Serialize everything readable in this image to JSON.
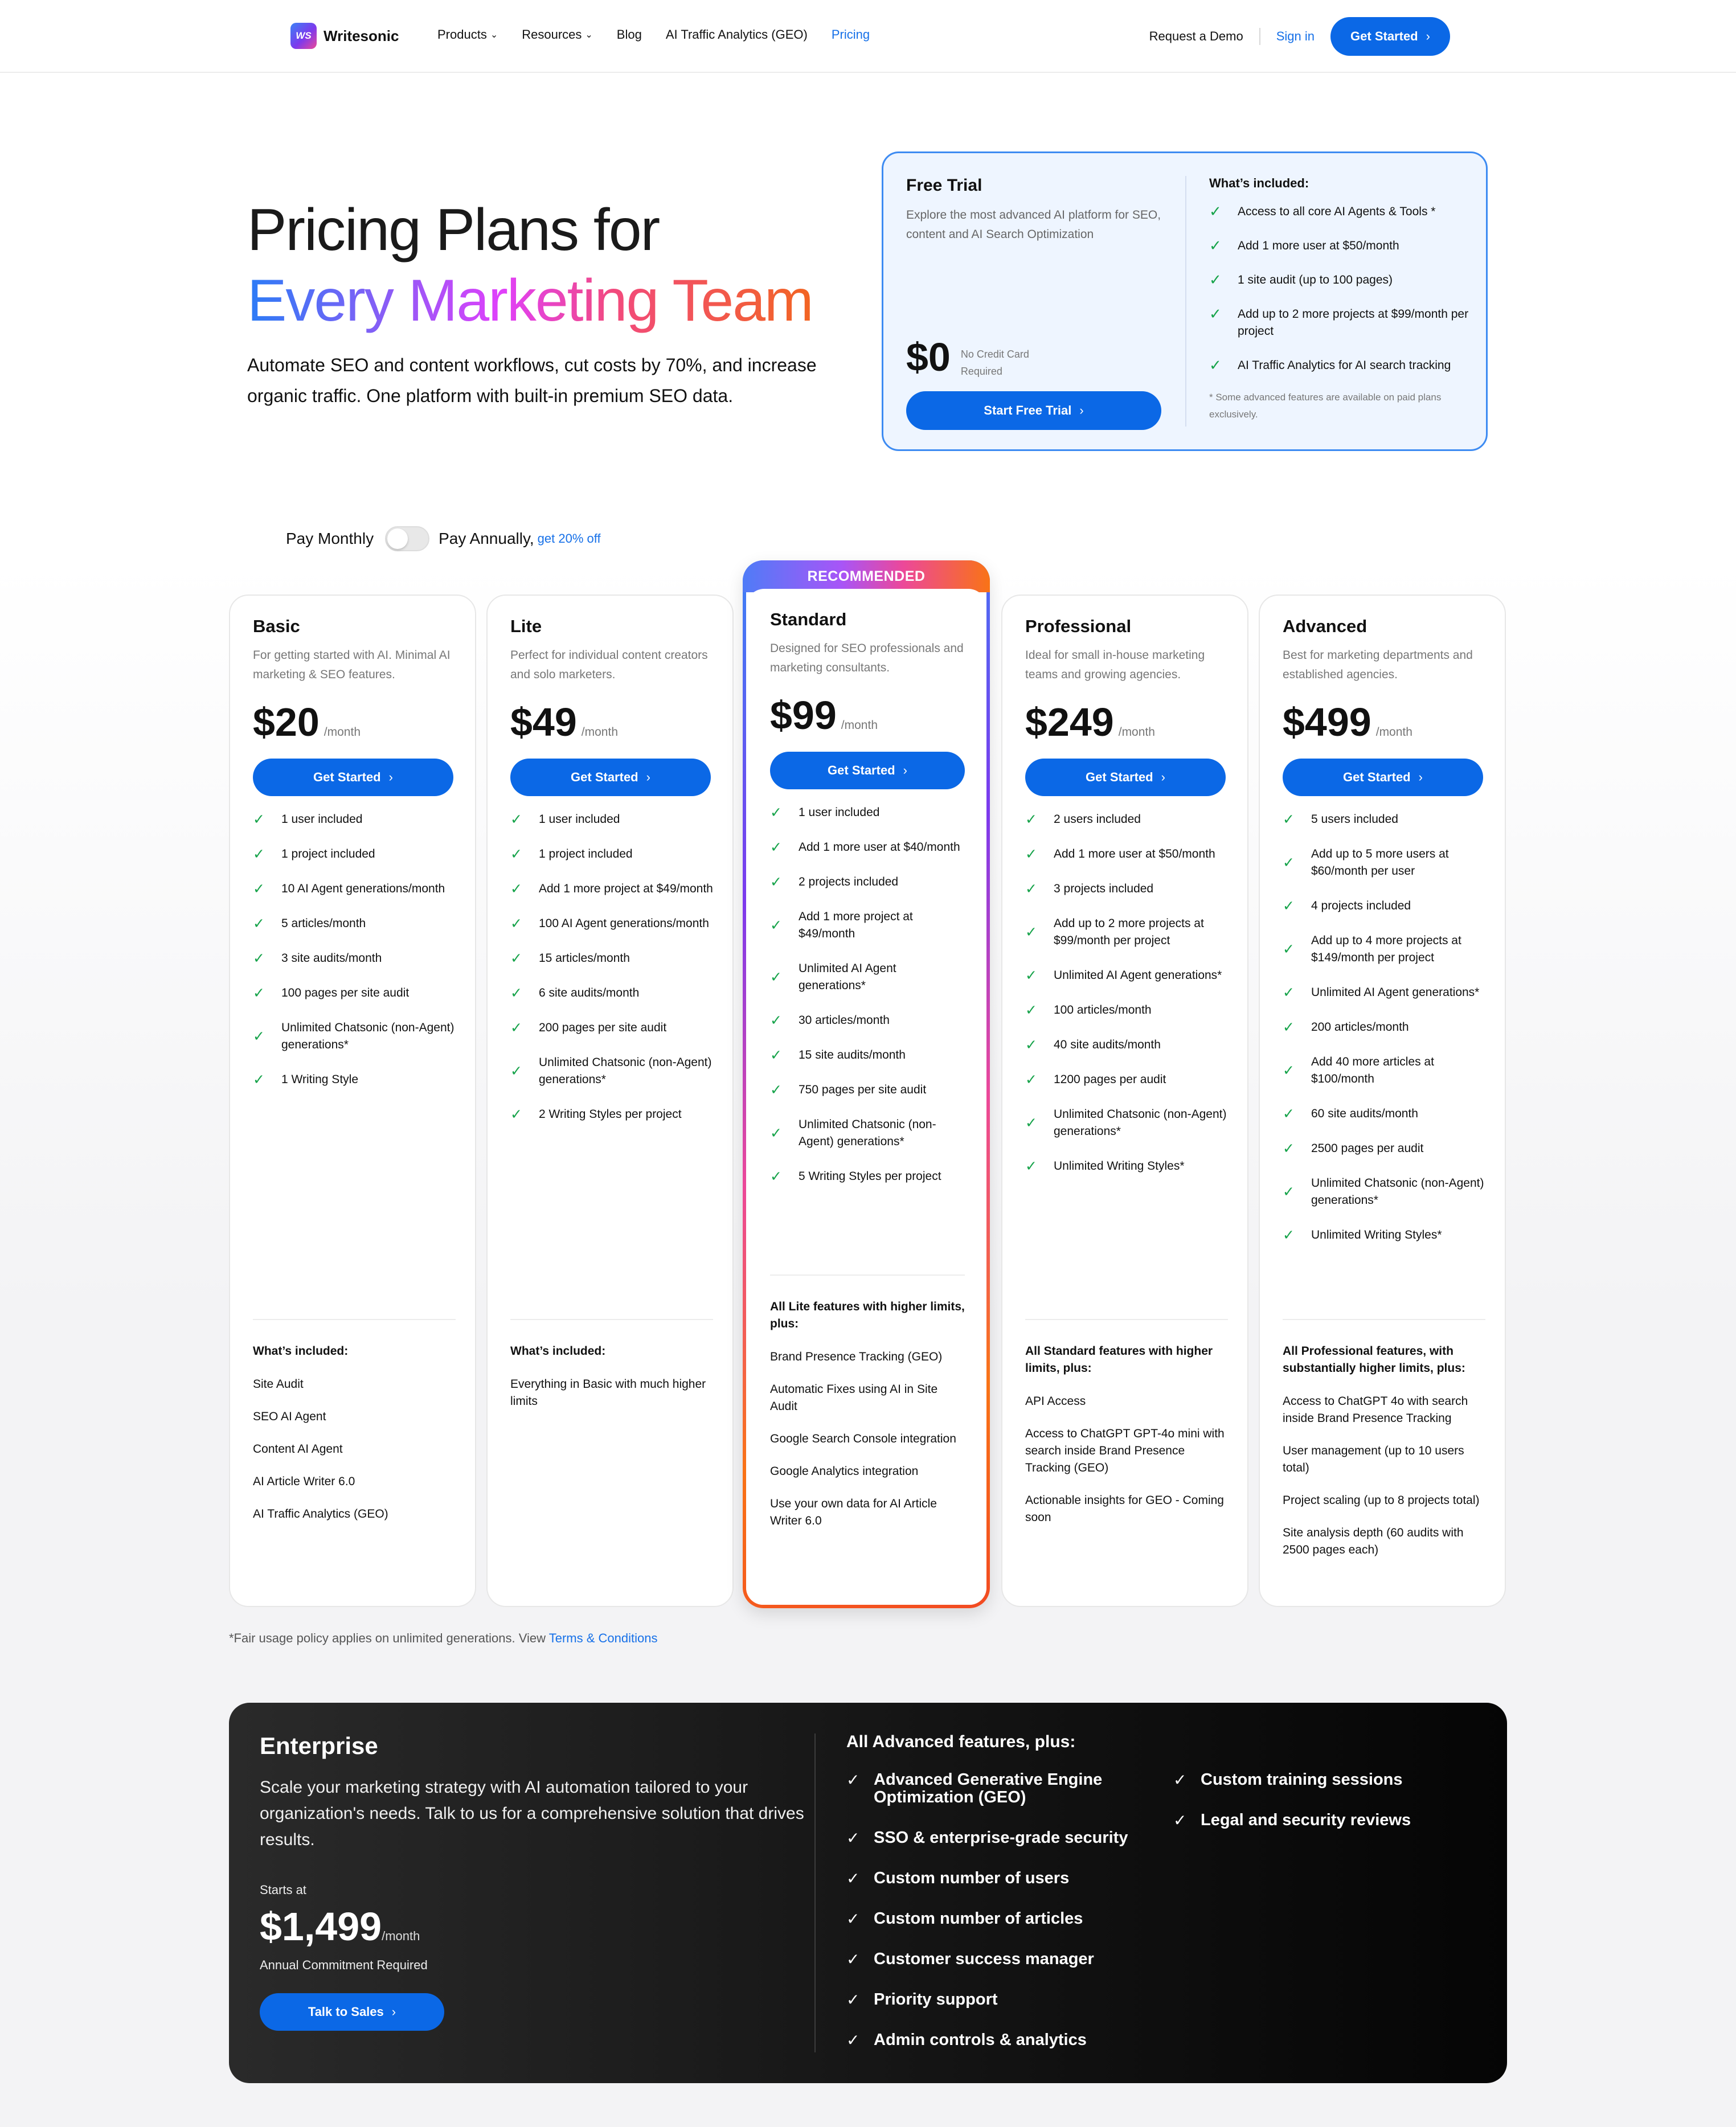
{
  "nav": {
    "logo_mark": "WS",
    "logo_text": "Writesonic",
    "links": [
      {
        "label": "Products",
        "dropdown": true
      },
      {
        "label": "Resources",
        "dropdown": true
      },
      {
        "label": "Blog",
        "dropdown": false
      },
      {
        "label": "AI Traffic Analytics (GEO)",
        "dropdown": false
      },
      {
        "label": "Pricing",
        "dropdown": false,
        "active": true
      }
    ],
    "demo": "Request a Demo",
    "signin": "Sign in",
    "cta": "Get Started"
  },
  "hero": {
    "title_line1": "Pricing Plans for",
    "title_line2": "Every Marketing Team",
    "subtitle": "Automate SEO and content workflows, cut costs by 70%, and increase organic traffic. One platform with built-in premium SEO data."
  },
  "trial": {
    "title": "Free Trial",
    "description": "Explore the most advanced AI platform for SEO, content and AI Search Optimization",
    "price": "$0",
    "price_note": "No Credit Card Required",
    "cta": "Start Free Trial",
    "included_heading": "What’s included:",
    "included": [
      "Access to all core AI Agents & Tools *",
      "Add 1 more user at $50/month",
      "1 site audit (up to 100 pages)",
      "Add up to 2 more projects at $99/month per project",
      "AI Traffic Analytics for AI search tracking"
    ],
    "footnote": "* Some advanced features are available on paid plans exclusively."
  },
  "billing": {
    "monthly_label": "Pay Monthly",
    "annual_label": "Pay Annually,",
    "discount": "get 20% off",
    "annual_selected": false
  },
  "plans": [
    {
      "name": "Basic",
      "description": "For getting started with AI. Minimal AI marketing & SEO features.",
      "price": "$20",
      "period": "/month",
      "cta": "Get Started",
      "features": [
        "1 user included",
        "1 project included",
        "10 AI Agent generations/month",
        "5 articles/month",
        "3 site audits/month",
        "100 pages per site audit",
        "Unlimited Chatsonic (non-Agent) generations*",
        "1 Writing Style"
      ],
      "included_heading": "What’s included:",
      "included": [
        "Site Audit",
        "SEO AI Agent",
        "Content AI Agent",
        "AI Article Writer 6.0",
        "AI Traffic Analytics (GEO)"
      ]
    },
    {
      "name": "Lite",
      "description": "Perfect for individual content creators and solo marketers.",
      "price": "$49",
      "period": "/month",
      "cta": "Get Started",
      "features": [
        "1 user included",
        "1 project included",
        "Add 1 more project at $49/month",
        "100 AI Agent generations/month",
        "15 articles/month",
        "6 site audits/month",
        "200 pages per site audit",
        "Unlimited Chatsonic (non-Agent) generations*",
        "2 Writing Styles per project"
      ],
      "included_heading": "What’s included:",
      "included": [
        "Everything in Basic with much higher limits"
      ]
    },
    {
      "name": "Standard",
      "badge": "RECOMMENDED",
      "description": "Designed for SEO professionals and marketing consultants.",
      "price": "$99",
      "period": "/month",
      "cta": "Get Started",
      "features": [
        "1 user included",
        "Add 1 more user at $40/month",
        "2 projects included",
        "Add 1 more project at $49/month",
        "Unlimited AI Agent generations*",
        "30 articles/month",
        "15 site audits/month",
        "750 pages per site audit",
        "Unlimited Chatsonic (non-Agent) generations*",
        "5 Writing Styles per project"
      ],
      "included_heading": "All Lite features with higher limits, plus:",
      "included": [
        "Brand Presence Tracking (GEO)",
        "Automatic Fixes using AI in Site Audit",
        "Google Search Console integration",
        "Google Analytics integration",
        "Use your own data for AI Article Writer 6.0"
      ]
    },
    {
      "name": "Professional",
      "description": "Ideal for small in-house marketing teams and growing agencies.",
      "price": "$249",
      "period": "/month",
      "cta": "Get Started",
      "features": [
        "2 users included",
        "Add 1 more user at $50/month",
        "3 projects included",
        "Add up to 2 more projects at $99/month per project",
        "Unlimited AI Agent generations*",
        "100 articles/month",
        "40 site audits/month",
        "1200 pages per audit",
        "Unlimited Chatsonic (non-Agent) generations*",
        "Unlimited Writing Styles*"
      ],
      "included_heading": "All Standard features with higher limits, plus:",
      "included": [
        "API Access",
        "Access to ChatGPT GPT-4o mini with search inside Brand Presence Tracking (GEO)",
        "Actionable insights for GEO - Coming soon"
      ]
    },
    {
      "name": "Advanced",
      "description": "Best for marketing departments and established agencies.",
      "price": "$499",
      "period": "/month",
      "cta": "Get Started",
      "features": [
        "5 users included",
        "Add up to 5 more users at $60/month per user",
        "4 projects included",
        "Add up to 4 more projects at $149/month per project",
        "Unlimited AI Agent generations*",
        "200 articles/month",
        "Add 40 more articles at $100/month",
        "60 site audits/month",
        "2500 pages per audit",
        "Unlimited Chatsonic (non-Agent) generations*",
        "Unlimited Writing Styles*"
      ],
      "included_heading": "All Professional features, with substantially higher limits, plus:",
      "included": [
        "Access to ChatGPT 4o with search inside Brand Presence Tracking",
        "User management (up to 10 users total)",
        "Project scaling (up to 8 projects total)",
        "Site analysis depth (60 audits with 2500 pages each)"
      ]
    }
  ],
  "fair_usage": {
    "text": "*Fair usage policy applies on unlimited generations. View",
    "link": "Terms & Conditions"
  },
  "enterprise": {
    "title": "Enterprise",
    "description": "Scale your marketing strategy with AI automation tailored to your organization's needs. Talk to us for a comprehensive solution that drives results.",
    "starts_at": "Starts at",
    "price": "$1,499",
    "period": "/month",
    "commitment": "Annual Commitment Required",
    "cta": "Talk to Sales",
    "features_heading": "All Advanced features, plus:",
    "features_col1": [
      "Advanced Generative Engine Optimization (GEO)",
      "SSO & enterprise-grade security",
      "Custom number of users",
      "Custom number of articles",
      "Customer success manager",
      "Priority support",
      "Admin controls & analytics"
    ],
    "features_col2": [
      "Custom training sessions",
      "Legal and security reviews"
    ]
  },
  "icons": {
    "check": "check-icon",
    "chevron_right": "chevron-right-icon",
    "chevron_down": "chevron-down-icon"
  },
  "colors": {
    "primary": "#0b68e6",
    "link": "#1670e8",
    "check": "#16a34a",
    "trial_border": "#3d8bf2",
    "trial_bg": "#eef5ff",
    "enterprise_bg": "#141414"
  }
}
